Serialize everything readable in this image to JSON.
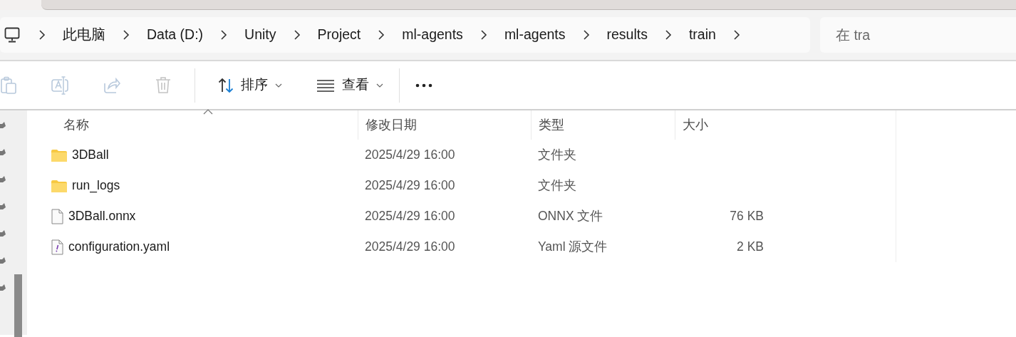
{
  "breadcrumb": [
    "此电脑",
    "Data (D:)",
    "Unity",
    "Project",
    "ml-agents",
    "ml-agents",
    "results",
    "train"
  ],
  "search": {
    "placeholder": "在 tra"
  },
  "toolbar": [
    {
      "kind": "paste",
      "disabled": true
    },
    {
      "kind": "rename",
      "disabled": true
    },
    {
      "kind": "share",
      "disabled": true
    },
    {
      "kind": "delete",
      "disabled": true
    },
    {
      "kind": "sort",
      "label": "排序",
      "disabled": false
    },
    {
      "kind": "view",
      "label": "查看",
      "disabled": false
    },
    {
      "kind": "more",
      "disabled": false
    }
  ],
  "table": {
    "columns": [
      "名称",
      "修改日期",
      "类型",
      "大小"
    ],
    "rows": [
      {
        "kind": "folder",
        "name": "3DBall",
        "modified": "2025/4/29 16:00",
        "type": "文件夹"
      },
      {
        "kind": "folder",
        "name": "run_logs",
        "modified": "2025/4/29 16:00",
        "type": "文件夹"
      },
      {
        "kind": "file",
        "name": "3DBall.onnx",
        "modified": "2025/4/29 16:00",
        "type": "ONNX 文件",
        "size": "76 KB"
      },
      {
        "kind": "yaml",
        "name": "configuration.yaml",
        "modified": "2025/4/29 16:00",
        "type": "Yaml 源文件",
        "size": "2 KB"
      }
    ]
  }
}
